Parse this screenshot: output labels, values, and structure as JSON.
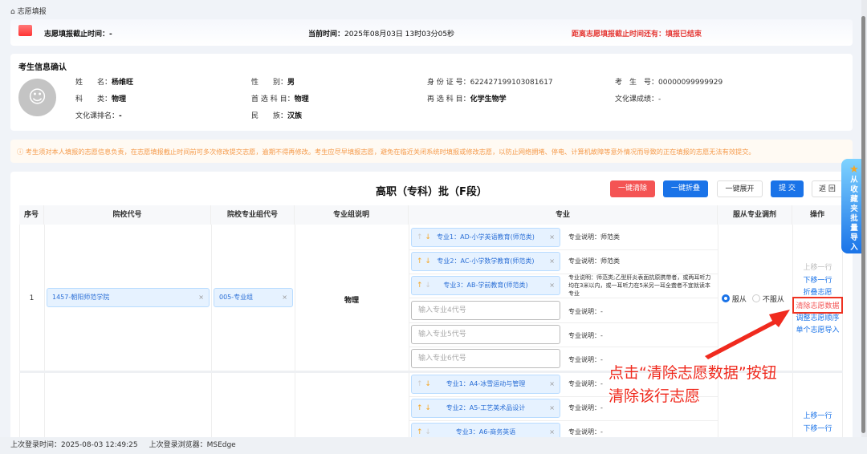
{
  "breadcrumb": "志愿填报",
  "header": {
    "deadline_label": "志愿填报截止时间：",
    "deadline_value": "-",
    "current_label": "当前时间：",
    "current_value": "2025年08月03日 13时03分05秒",
    "remaining": "距离志愿填报截止时间还有：填报已结束"
  },
  "student": {
    "title": "考生信息确认",
    "fields": [
      {
        "label": "姓　　名：",
        "value": "杨维旺"
      },
      {
        "label": "性　　别：",
        "value": "男"
      },
      {
        "label": "身 份 证 号：",
        "value": "622427199103081617"
      },
      {
        "label": "考　生　号：",
        "value": "00000099999929"
      },
      {
        "label": "科　　类：",
        "value": "物理"
      },
      {
        "label": "首 选 科 目：",
        "value": "物理"
      },
      {
        "label": "再 选 科 目：",
        "value": "化学生物学"
      },
      {
        "label": "文化课成绩：",
        "value": "-"
      },
      {
        "label": "文化课排名：",
        "value": "-"
      },
      {
        "label": "民　　族：",
        "value": "汉族"
      }
    ]
  },
  "notice": "考生须对本人填报的志愿信息负责，在志愿填报截止时间前可多次修改提交志愿，逾期不得再修改。考生应尽早填报志愿，避免在临近关闭系统时填报或修改志愿，以防止网络拥堵、停电、计算机故障等意外情况而导致的正在填报的志愿无法有效提交。",
  "main": {
    "title": "高职（专科）批（F段）",
    "buttons": {
      "clear_all": "一键清除",
      "collapse_all": "一键折叠",
      "expand_all": "一键展开",
      "submit": "提 交",
      "back": "返 回"
    },
    "columns": [
      "序号",
      "院校代号",
      "院校专业组代号",
      "专业组说明",
      "专业",
      "服从专业调剂",
      "操作"
    ],
    "rows": [
      {
        "index": "1",
        "school": "1457-朝阳师范学院",
        "group": "005-专业组",
        "group_desc": "物理",
        "majors": [
          {
            "label": "专业1：AD-小学英语教育(师范类)",
            "desc": "专业说明：师范类"
          },
          {
            "label": "专业2：AC-小学数学教育(师范类)",
            "desc": "专业说明：师范类"
          },
          {
            "label": "专业3：AB-学前教育(师范类)",
            "desc": "专业说明：师范类;乙型肝炎表面抗原携带者，或两耳听力均在3米以内，或一耳听力在5米另一耳全聋者不宜就读本专业"
          }
        ],
        "empty": [
          {
            "placeholder": "输入专业4代号",
            "desc": "专业说明：-"
          },
          {
            "placeholder": "输入专业5代号",
            "desc": "专业说明：-"
          },
          {
            "placeholder": "输入专业6代号",
            "desc": "专业说明：-"
          }
        ],
        "obey": "服从",
        "not_obey": "不服从",
        "ops": [
          "上移一行",
          "下移一行",
          "折叠志愿",
          "清除志愿数据",
          "调整志愿顺序",
          "单个志愿导入"
        ]
      },
      {
        "majors": [
          {
            "label": "专业1：A4-冰雪运动与管理",
            "desc": "专业说明：-"
          },
          {
            "label": "专业2：A5-工艺美术品设计",
            "desc": "专业说明：-"
          },
          {
            "label": "专业3：A6-商务英语",
            "desc": "专业说明：-"
          }
        ],
        "ops": [
          "上移一行",
          "下移一行"
        ]
      }
    ]
  },
  "side_button": "从收藏夹批量导入",
  "annotation": {
    "line1": "点击“清除志愿数据”按钮",
    "line2": "清除该行志愿"
  },
  "footer": {
    "login_time": "上次登录时间：2025-08-03 12:49:25",
    "browser": "上次登录浏览器：MSEdge"
  }
}
